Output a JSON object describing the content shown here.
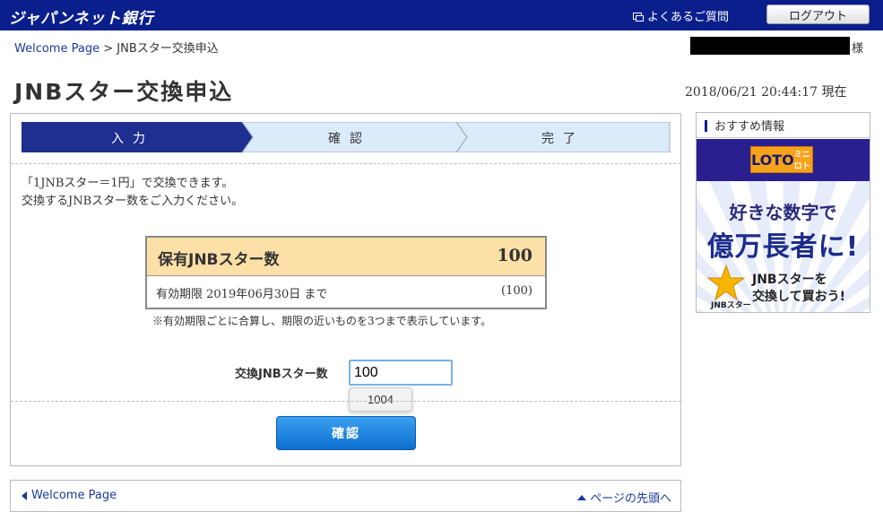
{
  "header": {
    "logo": "ジャパンネット銀行",
    "faq_label": "よくあるご質問",
    "logout_label": "ログアウト"
  },
  "breadcrumb": {
    "home": "Welcome Page",
    "separator": ">",
    "current": "JNBスター交換申込"
  },
  "user": {
    "honorific": "様"
  },
  "page": {
    "title": "JNBスター交換申込",
    "datetime": "2018/06/21 20:44:17 現在"
  },
  "steps": [
    {
      "label": "入力",
      "active": true
    },
    {
      "label": "確認",
      "active": false
    },
    {
      "label": "完了",
      "active": false
    }
  ],
  "intro": {
    "line1": "「1JNBスター＝1円」で交換できます。",
    "line2": "交換するJNBスター数をご入力ください。"
  },
  "holdings": {
    "label": "保有JNBスター数",
    "total": "100",
    "expiry_label": "有効期限 2019年06月30日 まで",
    "expiry_value": "(100)",
    "note": "※有効期限ごとに合算し、期限の近いものを3つまで表示しています。"
  },
  "exchange": {
    "label": "交換JNBスター数",
    "value": "100",
    "suggestion": "1004"
  },
  "confirm_button": "確認",
  "sidebar": {
    "header": "おすすめ情報",
    "banner": {
      "logo_a": "LOTO",
      "logo_b": "ミニロト",
      "line1": "好きな数字で",
      "line2": "億万長者に!",
      "line3a": "JNBスターを",
      "line3b": "交換して買おう!",
      "star_caption": "JNBスター"
    }
  },
  "footer": {
    "back_label": "Welcome Page",
    "top_label": "ページの先頭へ"
  },
  "colors": {
    "brand": "#0a1f8c",
    "step_active": "#1e2f8f",
    "step_inactive": "#dcebfa",
    "holdings_header": "#fde0a8",
    "button": "#1a7fe0"
  }
}
